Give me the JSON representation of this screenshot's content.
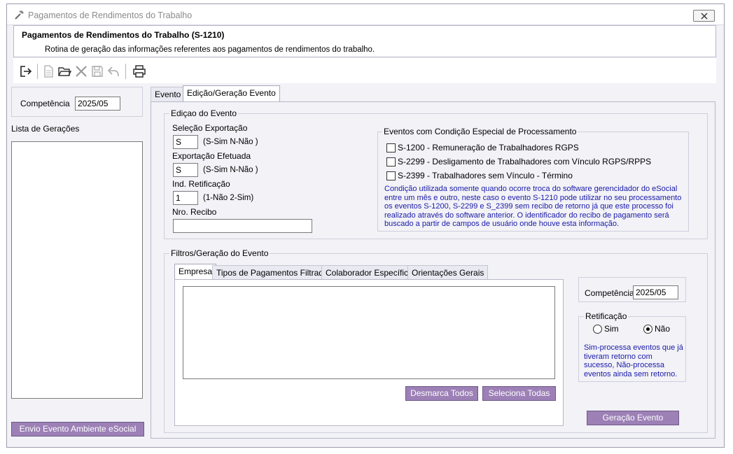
{
  "window": {
    "title": "Pagamentos de Rendimentos do Trabalho",
    "close_label": "X"
  },
  "header": {
    "title": "Pagamentos de Rendimentos do Trabalho (S-1210)",
    "subtitle": "Rotina de geração das informações referentes aos pagamentos de rendimentos do trabalho."
  },
  "toolbar": {
    "icons": [
      "exit-icon",
      "new-document-icon",
      "open-folder-icon",
      "delete-icon",
      "save-icon",
      "undo-icon",
      "print-icon"
    ]
  },
  "left": {
    "competencia_label": "Competência",
    "competencia_value": "2025/05",
    "list_label": "Lista de Gerações",
    "send_button": "Envio Evento Ambiente eSocial"
  },
  "tabs": [
    {
      "label": "Evento",
      "active": false
    },
    {
      "label": "Edição/Geração Evento",
      "active": true
    }
  ],
  "edicao": {
    "group_title": "Ediçao do Evento",
    "selecao_label": "Seleção Exportação",
    "selecao_value": "S",
    "selecao_hint": "(S-Sim N-Não )",
    "exportacao_label": "Exportação Efetuada",
    "exportacao_value": "S",
    "exportacao_hint": "(S-Sim N-Não )",
    "retificacao_label": "Ind. Retificação",
    "retificacao_value": "1",
    "retificacao_hint": "(1-Não 2-Sim)",
    "recibo_label": "Nro. Recibo",
    "recibo_value": ""
  },
  "especial": {
    "group_title": "Eventos com Condição Especial de Processamento",
    "items": [
      {
        "label": "S-1200 - Remuneração de Trabalhadores RGPS",
        "checked": false
      },
      {
        "label": "S-2299 - Desligamento de Trabalhadores com Vínculo RGPS/RPPS",
        "checked": false
      },
      {
        "label": "S-2399 - Trabalhadores sem Vínculo - Término",
        "checked": false
      }
    ],
    "note": "Condição utilizada somente quando ocorre troca do software gerencidador do eSocial entre um mês e outro, neste caso o evento S-1210 pode utilizar no seu processamento os eventos S-1200, S-2299 e S_2399 sem recibo de retorno já que este processo foi realizado através do software anterior. O identificador do recibo de pagamento será buscado a partir de campos de usuário onde houve esta informação."
  },
  "filtros": {
    "group_title": "Filtros/Geração do Evento",
    "tabs": [
      {
        "label": "Empresa",
        "active": true
      },
      {
        "label": "Tipos de Pagamentos Filtrados",
        "active": false
      },
      {
        "label": "Colaborador Específico",
        "active": false
      },
      {
        "label": "Orientações Gerais",
        "active": false
      }
    ],
    "desmarca_button": "Desmarca Todos",
    "seleciona_button": "Seleciona Todas",
    "competencia_label": "Competência",
    "competencia_value": "2025/05",
    "retificacao_title": "Retificação",
    "sim_label": "Sim",
    "nao_label": "Não",
    "selected": "Não",
    "retificacao_note": "Sim-processa eventos que já tiveram retorno com sucesso, Não-processa eventos ainda sem retorno.",
    "geracao_button": "Geração Evento"
  },
  "colors": {
    "accent": "#9c80b6",
    "note_text": "#1a1aa8",
    "panel_bg": "#f2f2f7"
  }
}
